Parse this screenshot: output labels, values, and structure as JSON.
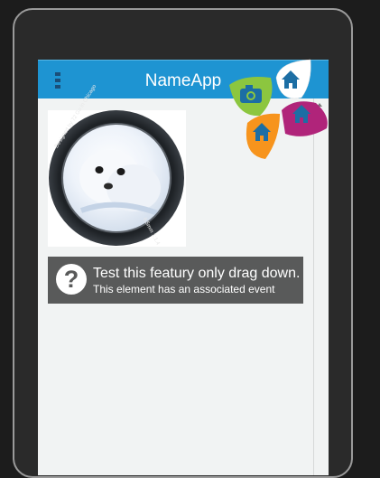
{
  "app": {
    "title": "NameApp"
  },
  "image_card": {
    "ring_text_top": "Designed by 72 Go in Chicago",
    "ring_text_bottom": "6.5mm 1:1.4"
  },
  "info": {
    "icon_glyph": "?",
    "title": "Test this featury only drag down.",
    "subtitle": "This element has an associated event"
  },
  "petal_menu": {
    "items": [
      {
        "name": "camera",
        "color": "#8cc63f"
      },
      {
        "name": "home",
        "color": "#ffffff"
      },
      {
        "name": "home",
        "color": "#f7941d"
      },
      {
        "name": "home",
        "color": "#b0247a"
      }
    ]
  },
  "colors": {
    "appbar": "#1e94d2",
    "info_bar": "#595a5a",
    "screen_bg": "#f1f3f3"
  }
}
